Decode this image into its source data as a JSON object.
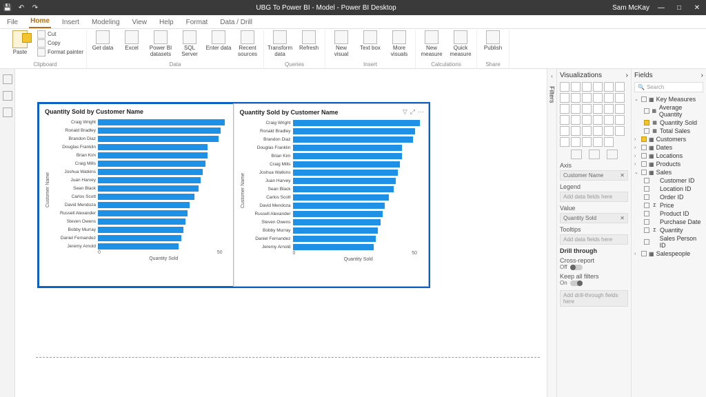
{
  "titlebar": {
    "title": "UBG To Power BI - Model - Power BI Desktop",
    "user": "Sam McKay"
  },
  "tabs": [
    "File",
    "Home",
    "Insert",
    "Modeling",
    "View",
    "Help",
    "Format",
    "Data / Drill"
  ],
  "active_tab": "Home",
  "ribbon": {
    "clipboard": {
      "paste": "Paste",
      "cut": "Cut",
      "copy": "Copy",
      "format_painter": "Format painter",
      "group": "Clipboard"
    },
    "data": {
      "items": [
        "Get data",
        "Excel",
        "Power BI datasets",
        "SQL Server",
        "Enter data",
        "Recent sources"
      ],
      "group": "Data"
    },
    "queries": {
      "items": [
        "Transform data",
        "Refresh"
      ],
      "group": "Queries"
    },
    "insert": {
      "items": [
        "New visual",
        "Text box",
        "More visuals"
      ],
      "group": "Insert"
    },
    "calc": {
      "items": [
        "New measure",
        "Quick measure"
      ],
      "group": "Calculations"
    },
    "share": {
      "items": [
        "Publish"
      ],
      "group": "Share"
    }
  },
  "chart_data": [
    {
      "type": "bar",
      "title": "Quantity Sold by Customer Name",
      "xlabel": "Quantity Sold",
      "ylabel": "Customer Name",
      "xlim": [
        0,
        60
      ],
      "xticks": [
        0,
        50
      ],
      "categories": [
        "Craig Wright",
        "Ronald Bradley",
        "Brandon Diaz",
        "Douglas Franklin",
        "Brian Kim",
        "Craig Mills",
        "Joshua Watkins",
        "Juan Harvey",
        "Sean Black",
        "Carlos Scott",
        "David Mendoza",
        "Russell Alexander",
        "Steven Owens",
        "Bobby Murray",
        "Daniel Fernandez",
        "Jeremy Arnold"
      ],
      "values": [
        58,
        56,
        55,
        50,
        50,
        49,
        48,
        47,
        46,
        44,
        42,
        41,
        40,
        39,
        38,
        37
      ]
    },
    {
      "type": "bar",
      "title": "Quantity Sold by Customer Name",
      "xlabel": "Quantity Sold",
      "ylabel": "Customer Name",
      "xlim": [
        0,
        60
      ],
      "xticks": [
        0,
        50
      ],
      "categories": [
        "Craig Wright",
        "Ronald Bradley",
        "Brandon Diaz",
        "Douglas Franklin",
        "Brian Kim",
        "Craig Mills",
        "Joshua Watkins",
        "Juan Harvey",
        "Sean Black",
        "Carlos Scott",
        "David Mendoza",
        "Russell Alexander",
        "Steven Owens",
        "Bobby Murray",
        "Daniel Fernandez",
        "Jeremy Arnold"
      ],
      "values": [
        58,
        56,
        55,
        50,
        50,
        49,
        48,
        47,
        46,
        44,
        42,
        41,
        40,
        39,
        38,
        37
      ]
    }
  ],
  "viz_pane": {
    "title": "Visualizations",
    "sections": {
      "axis": "Axis",
      "legend": "Legend",
      "value": "Value",
      "tooltips": "Tooltips",
      "drill": "Drill through",
      "cross": "Cross-report",
      "keep": "Keep all filters"
    },
    "wells": {
      "axis": "Customer Name",
      "legend": "Add data fields here",
      "value": "Quantity Sold",
      "tooltips": "Add data fields here",
      "drill": "Add drill-through fields here"
    },
    "off": "Off",
    "on": "On"
  },
  "fields_pane": {
    "title": "Fields",
    "search": "Search",
    "tables": [
      {
        "name": "Key Measures",
        "expanded": true,
        "measures": [
          {
            "name": "Average Quantity",
            "checked": false
          },
          {
            "name": "Quantity Sold",
            "checked": true
          },
          {
            "name": "Total Sales",
            "checked": false
          }
        ]
      },
      {
        "name": "Customers",
        "expanded": false,
        "checked": true
      },
      {
        "name": "Dates",
        "expanded": false
      },
      {
        "name": "Locations",
        "expanded": false
      },
      {
        "name": "Products",
        "expanded": false
      },
      {
        "name": "Sales",
        "expanded": true,
        "fields": [
          {
            "name": "Customer ID"
          },
          {
            "name": "Location ID"
          },
          {
            "name": "Order ID"
          },
          {
            "name": "Price",
            "sigma": true
          },
          {
            "name": "Product ID"
          },
          {
            "name": "Purchase Date"
          },
          {
            "name": "Quantity",
            "sigma": true
          },
          {
            "name": "Sales Person ID"
          }
        ]
      },
      {
        "name": "Salespeople",
        "expanded": false
      }
    ]
  },
  "filters_label": "Filters"
}
